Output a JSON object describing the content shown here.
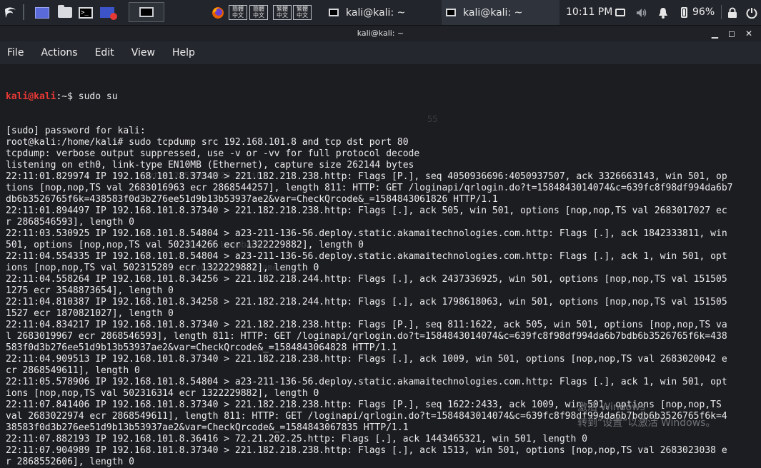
{
  "panel": {
    "cjk_tile_1": "簡體\n中文",
    "cjk_tile_2": "繁體\n中文",
    "task_terminal_1": "kali@kali: ~",
    "task_terminal_2": "kali@kali: ~",
    "clock": "10:11 PM",
    "battery": "96%"
  },
  "window": {
    "title": "kali@kali: ~",
    "menu": [
      "File",
      "Actions",
      "Edit",
      "View",
      "Help"
    ]
  },
  "terminal": {
    "prompt_user": "kali@kali",
    "prompt_rest": ":~$ sudo su",
    "lines": [
      "[sudo] password for kali:",
      "root@kali:/home/kali# sudo tcpdump src 192.168.101.8 and tcp dst port 80",
      "tcpdump: verbose output suppressed, use -v or -vv for full protocol decode",
      "listening on eth0, link-type EN10MB (Ethernet), capture size 262144 bytes",
      "22:11:01.829974 IP 192.168.101.8.37340 > 221.182.218.238.http: Flags [P.], seq 4050936696:4050937507, ack 3326663143, win 501, op",
      "tions [nop,nop,TS val 2683016963 ecr 2868544257], length 811: HTTP: GET /loginapi/qrlogin.do?t=1584843014074&c=639fc8f98df994da6b7",
      "db6b3526765f6k=438583f0d3b276ee51d9b13b53937ae2&var=CheckQrcode&_=1584843061826 HTTP/1.1",
      "22:11:01.894497 IP 192.168.101.8.37340 > 221.182.218.238.http: Flags [.], ack 505, win 501, options [nop,nop,TS val 2683017027 ec",
      "r 2868546593], length 0",
      "22:11:03.530925 IP 192.168.101.8.54804 > a23-211-136-56.deploy.static.akamaitechnologies.com.http: Flags [.], ack 1842333811, win",
      "501, options [nop,nop,TS val 502314266 ecr 1322229882], length 0",
      "22:11:04.554335 IP 192.168.101.8.54804 > a23-211-136-56.deploy.static.akamaitechnologies.com.http: Flags [.], ack 1, win 501, opt",
      "ions [nop,nop,TS val 502315289 ecr 1322229882], length 0",
      "22:11:04.558264 IP 192.168.101.8.34256 > 221.182.218.244.http: Flags [.], ack 2437336925, win 501, options [nop,nop,TS val 151505",
      "1275 ecr 3548873654], length 0",
      "22:11:04.810387 IP 192.168.101.8.34258 > 221.182.218.244.http: Flags [.], ack 1798618063, win 501, options [nop,nop,TS val 151505",
      "1527 ecr 1870821027], length 0",
      "22:11:04.834217 IP 192.168.101.8.37340 > 221.182.218.238.http: Flags [P.], seq 811:1622, ack 505, win 501, options [nop,nop,TS va",
      "l 2683019967 ecr 2868546593], length 811: HTTP: GET /loginapi/qrlogin.do?t=1584843014074&c=639fc8f98df994da6b7bdb6b3526765f6k=438",
      "583f0d3b276ee51d9b13b53937ae2&var=CheckQrcode&_=1584843064828 HTTP/1.1",
      "22:11:04.909513 IP 192.168.101.8.37340 > 221.182.218.238.http: Flags [.], ack 1009, win 501, options [nop,nop,TS val 2683020042 e",
      "cr 2868549611], length 0",
      "22:11:05.578906 IP 192.168.101.8.54804 > a23-211-136-56.deploy.static.akamaitechnologies.com.http: Flags [.], ack 1, win 501, opt",
      "ions [nop,nop,TS val 502316314 ecr 1322229882], length 0",
      "22:11:07.841406 IP 192.168.101.8.37340 > 221.182.218.238.http: Flags [P.], seq 1622:2433, ack 1009, win 501, options [nop,nop,TS",
      "val 2683022974 ecr 2868549611], length 811: HTTP: GET /loginapi/qrlogin.do?t=1584843014074&c=639fc8f98df994da6b7bdb6b3526765f6k=4",
      "38583f0d3b276ee51d9b13b53937ae2&var=CheckQrcode&_=1584843067835 HTTP/1.1",
      "22:11:07.882193 IP 192.168.101.8.36416 > 72.21.202.25.http: Flags [.], ack 1443465321, win 501, length 0",
      "22:11:07.904989 IP 192.168.101.8.37340 > 221.182.218.238.http: Flags [.], ack 1513, win 501, options [nop,nop,TS val 2683023038 e",
      "r 2868552606], length 0"
    ]
  },
  "watermark": {
    "line1": "激活 Windows",
    "line2": "转到“设置”以激活 Windows。"
  },
  "ghost_text": {
    "bytes": "bytes 235500 (229.9 KiB)",
    "loopback": "(Local Loopback)",
    "overruns": "overruns 0  frame 0",
    "port": "55"
  }
}
